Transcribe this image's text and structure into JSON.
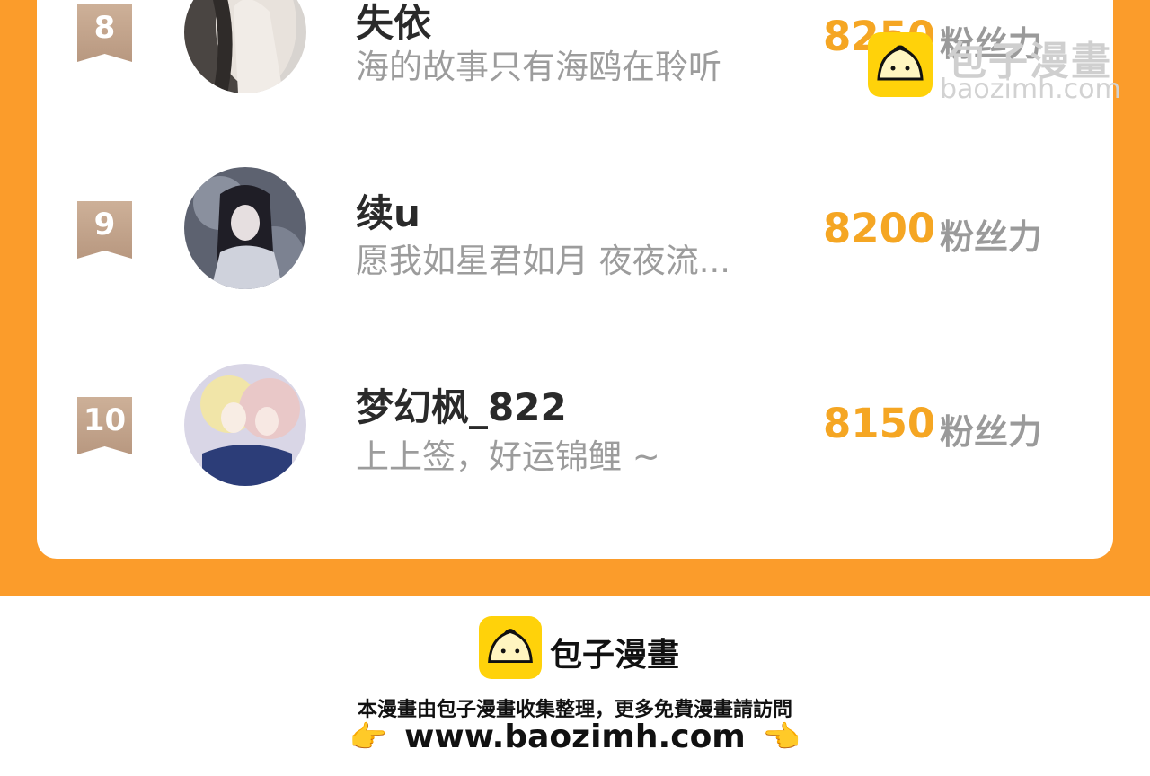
{
  "ranking": [
    {
      "rank": "8",
      "name": "失依",
      "bio": "海的故事只有海鸥在聆听",
      "fans": "8250",
      "unit": "粉丝力"
    },
    {
      "rank": "9",
      "name": "续u",
      "bio": "愿我如星君如月 夜夜流...",
      "fans": "8200",
      "unit": "粉丝力"
    },
    {
      "rank": "10",
      "name": "梦幻枫_822",
      "bio": "上上签，好运锦鲤 ~",
      "fans": "8150",
      "unit": "粉丝力"
    }
  ],
  "watermark": {
    "title": "包子漫畫",
    "url": "baozimh.com"
  },
  "footer": {
    "brand": "包子漫畫",
    "note": "本漫畫由包子漫畫收集整理，更多免費漫畫請訪問",
    "url": "www.baozimh.com",
    "hand_left": "👉",
    "hand_right": "👈"
  },
  "colors": {
    "accent": "#fb9c2b",
    "score": "#f5a623",
    "logo": "#ffd20a"
  }
}
